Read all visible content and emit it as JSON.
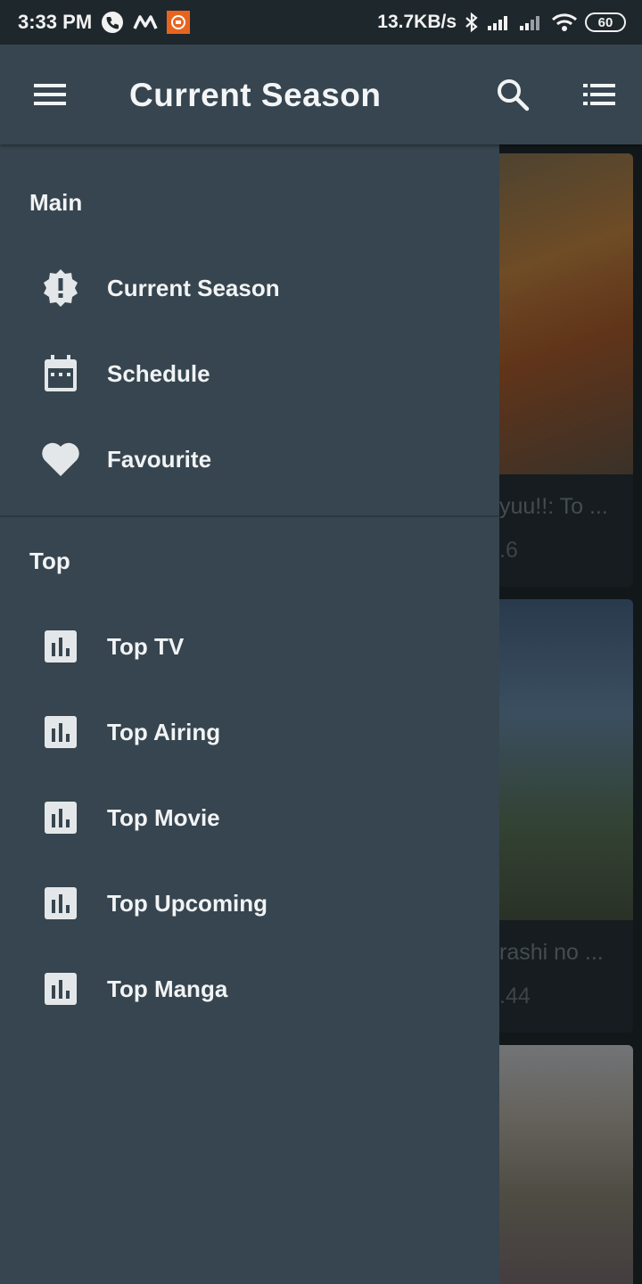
{
  "status_bar": {
    "time": "3:33 PM",
    "net_speed": "13.7KB/s",
    "battery": "60",
    "icons": [
      "call-icon",
      "app-m-icon",
      "app-notification-icon",
      "bluetooth-icon",
      "signal-icon",
      "signal-icon",
      "wifi-icon",
      "battery-icon"
    ]
  },
  "app_bar": {
    "title": "Current Season",
    "icons": [
      "menu-icon",
      "search-icon",
      "list-view-icon"
    ]
  },
  "drawer": {
    "sections": [
      {
        "header": "Main",
        "items": [
          {
            "label": "Current Season",
            "icon": "new-releases-icon"
          },
          {
            "label": "Schedule",
            "icon": "calendar-icon"
          },
          {
            "label": "Favourite",
            "icon": "heart-icon"
          }
        ]
      },
      {
        "header": "Top",
        "items": [
          {
            "label": "Top TV",
            "icon": "bar-chart-icon"
          },
          {
            "label": "Top Airing",
            "icon": "bar-chart-icon"
          },
          {
            "label": "Top Movie",
            "icon": "bar-chart-icon"
          },
          {
            "label": "Top Upcoming",
            "icon": "bar-chart-icon"
          },
          {
            "label": "Top Manga",
            "icon": "bar-chart-icon"
          }
        ]
      }
    ]
  },
  "background_cards": [
    {
      "title": "yuu!!: To ...",
      "score": ".6"
    },
    {
      "title": "rashi no ...",
      "score": ".44"
    },
    {
      "title": "",
      "score": ""
    }
  ],
  "colors": {
    "app_bar": "#36454f",
    "drawer": "#36454f",
    "status_bar": "#1e272c",
    "text": "#f1f3f4",
    "icon": "#e4e7e9"
  }
}
